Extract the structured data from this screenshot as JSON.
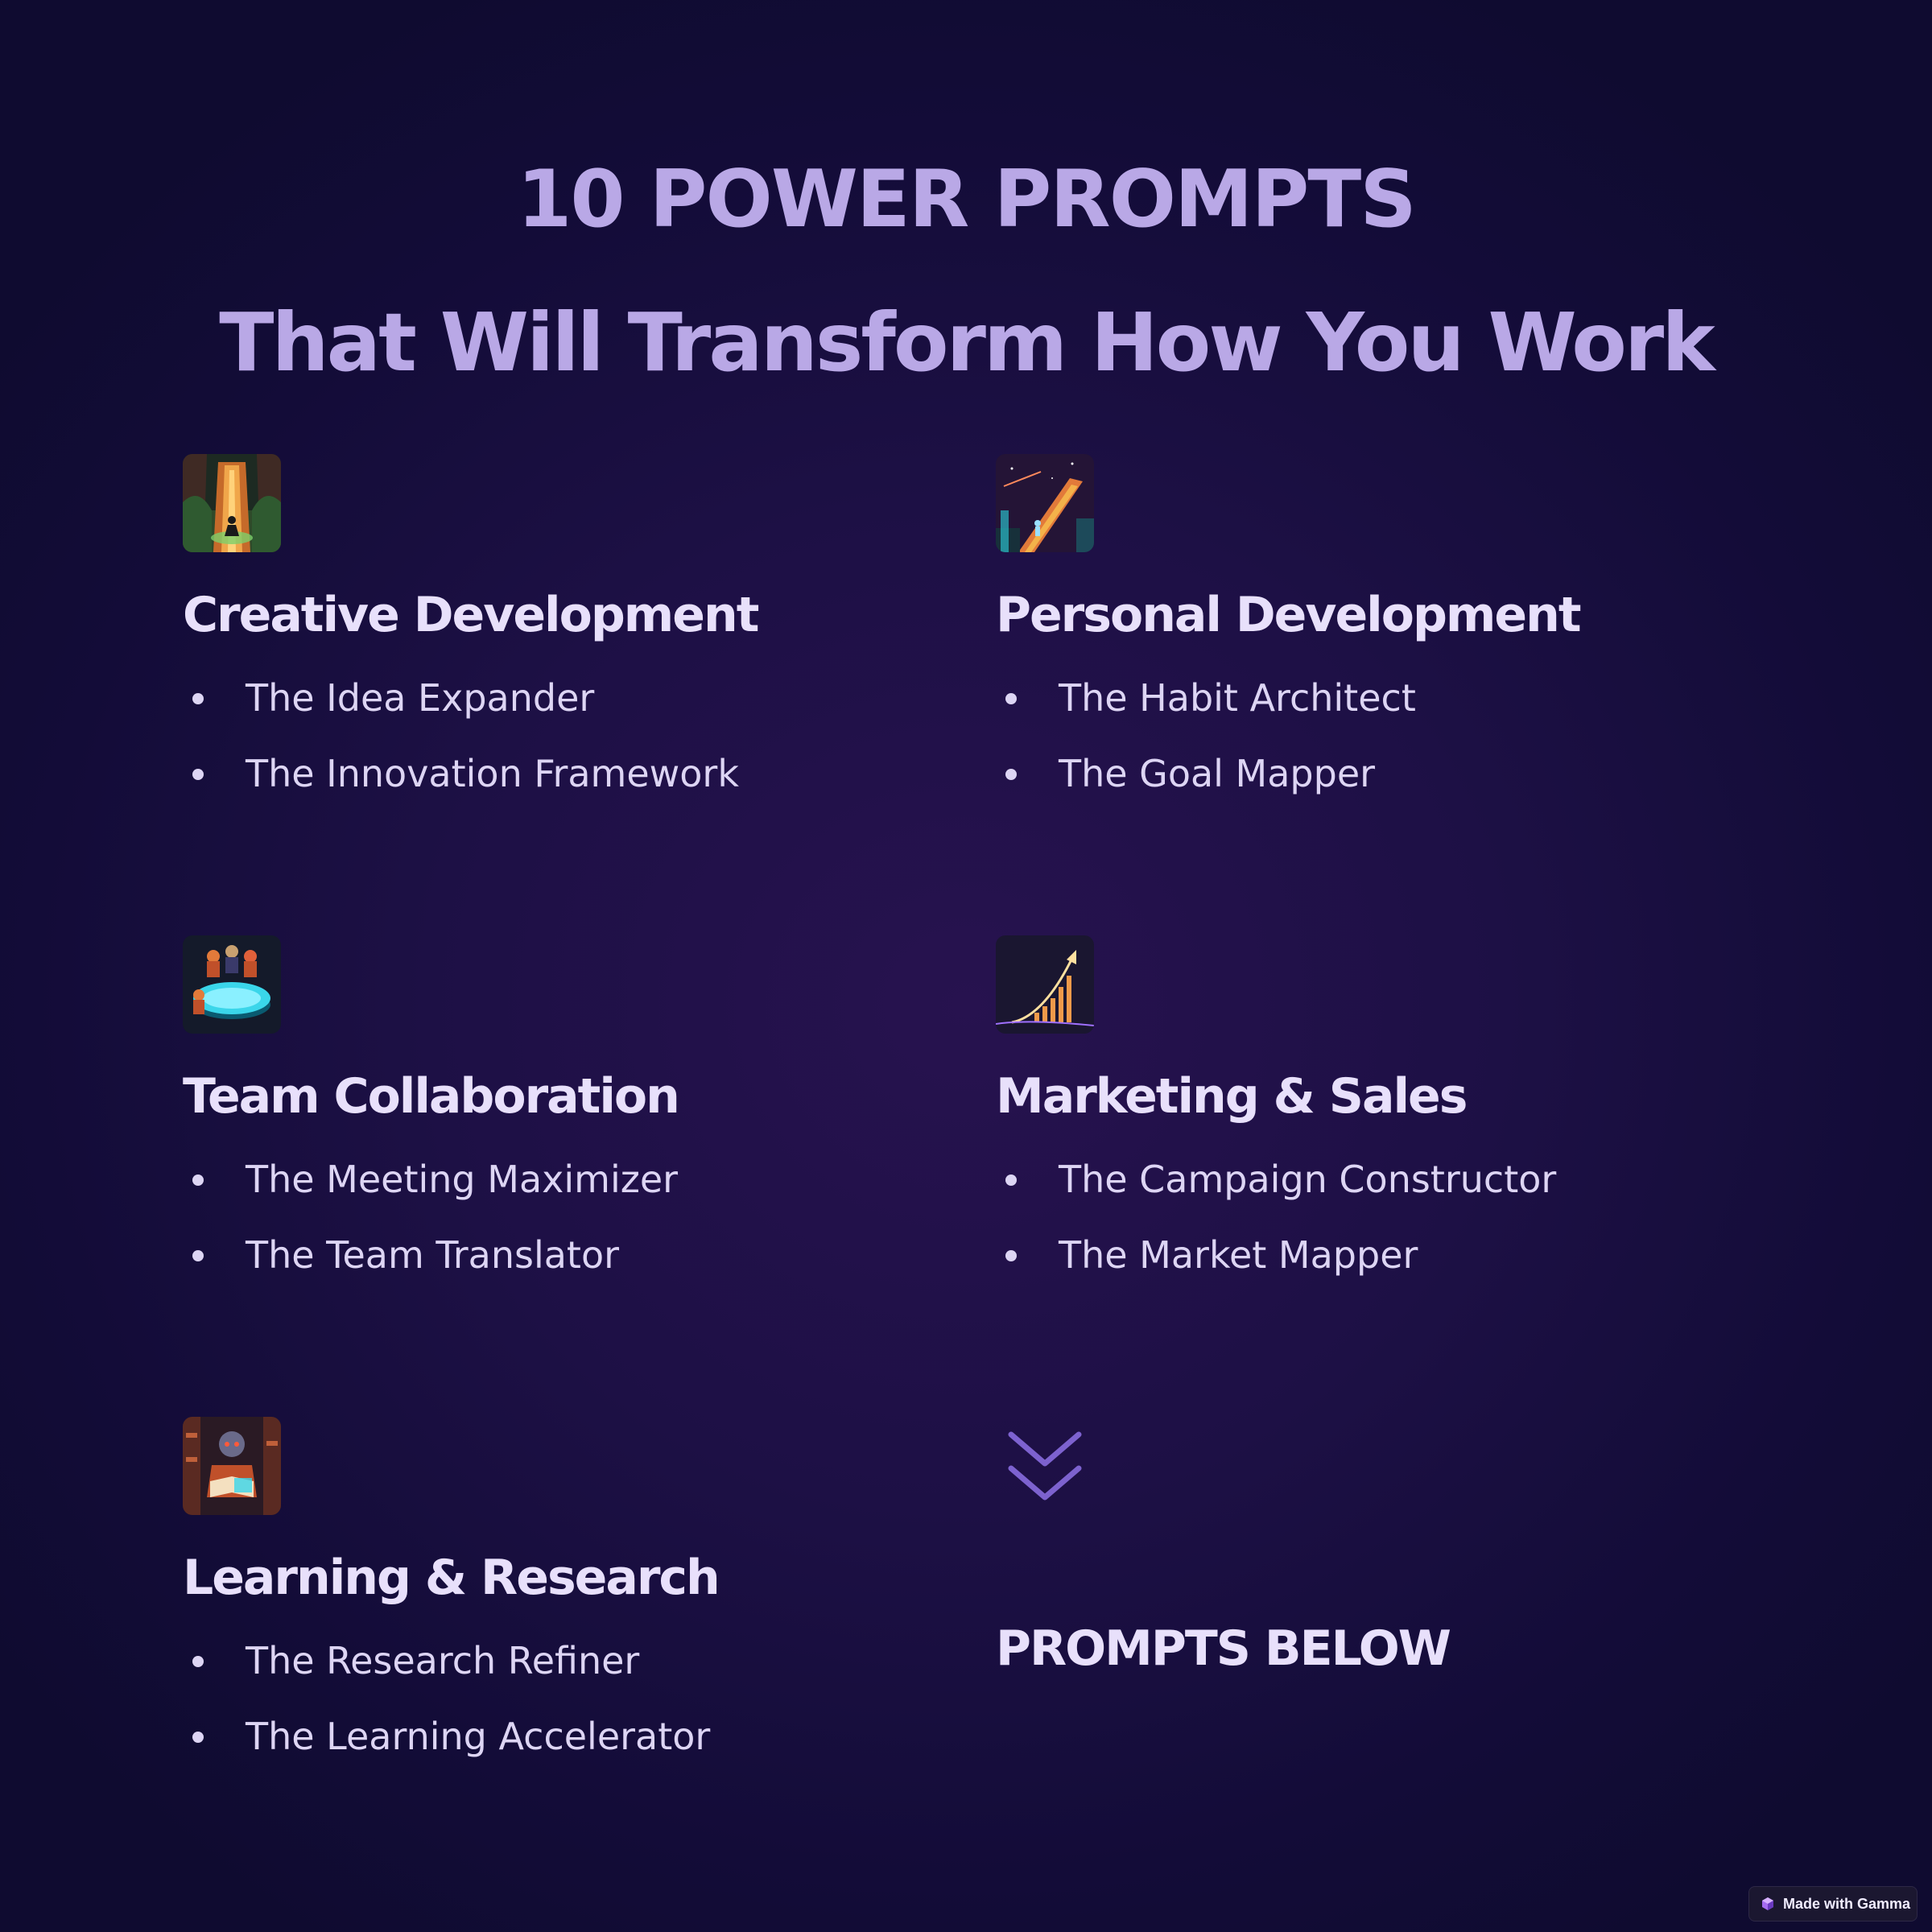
{
  "header": {
    "title_line1": "10 POWER PROMPTS",
    "title_line2": "That Will Transform How You Work"
  },
  "sections": [
    {
      "heading": "Creative Development",
      "icon": "meditation-forest-icon",
      "items": [
        "The Idea Expander",
        "The Innovation Framework"
      ]
    },
    {
      "heading": "Personal Development",
      "icon": "staircase-climb-icon",
      "items": [
        "The Habit Architect",
        "The Goal Mapper"
      ]
    },
    {
      "heading": "Team Collaboration",
      "icon": "team-table-icon",
      "items": [
        "The Meeting Maximizer",
        "The Team Translator"
      ]
    },
    {
      "heading": "Marketing & Sales",
      "icon": "growth-chart-icon",
      "items": [
        "The Campaign Constructor",
        "The Market Mapper"
      ]
    },
    {
      "heading": "Learning & Research",
      "icon": "reading-robot-icon",
      "items": [
        "The Research Refiner",
        "The Learning Accelerator"
      ]
    }
  ],
  "cta": {
    "label": "PROMPTS BELOW",
    "icon": "double-chevron-down-icon"
  },
  "badge": {
    "label": "Made with Gamma",
    "icon": "gamma-logo-icon"
  },
  "colors": {
    "background": "#1d1045",
    "title": "#b9a8e6",
    "heading": "#e8e0fb",
    "body_text": "#ddd5f4",
    "chevron": "#7d62cf"
  }
}
